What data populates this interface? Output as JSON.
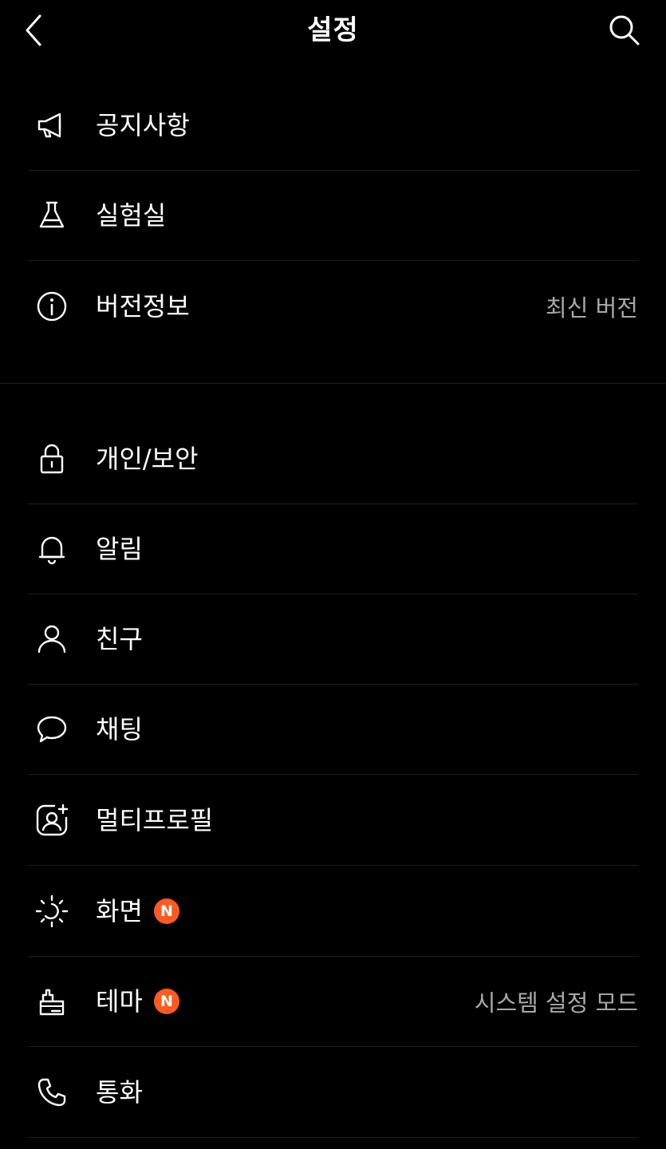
{
  "header": {
    "title": "설정"
  },
  "group1": [
    {
      "label": "공지사항",
      "icon": "megaphone-icon",
      "value": ""
    },
    {
      "label": "실험실",
      "icon": "flask-icon",
      "value": ""
    },
    {
      "label": "버전정보",
      "icon": "info-icon",
      "value": "최신 버전"
    }
  ],
  "group2": [
    {
      "label": "개인/보안",
      "icon": "lock-icon",
      "value": ""
    },
    {
      "label": "알림",
      "icon": "bell-icon",
      "value": ""
    },
    {
      "label": "친구",
      "icon": "person-icon",
      "value": ""
    },
    {
      "label": "채팅",
      "icon": "chat-bubble-icon",
      "value": ""
    },
    {
      "label": "멀티프로필",
      "icon": "multi-profile-icon",
      "value": ""
    },
    {
      "label": "화면",
      "icon": "brightness-icon",
      "value": "",
      "badge": "N"
    },
    {
      "label": "테마",
      "icon": "paint-brush-icon",
      "value": "시스템 설정 모드",
      "badge": "N"
    },
    {
      "label": "통화",
      "icon": "phone-icon",
      "value": ""
    }
  ],
  "colors": {
    "background": "#000000",
    "text": "#ffffff",
    "secondary_text": "#a8a8a8",
    "divider": "#1e1e1e",
    "badge": "#ff5a1f"
  }
}
